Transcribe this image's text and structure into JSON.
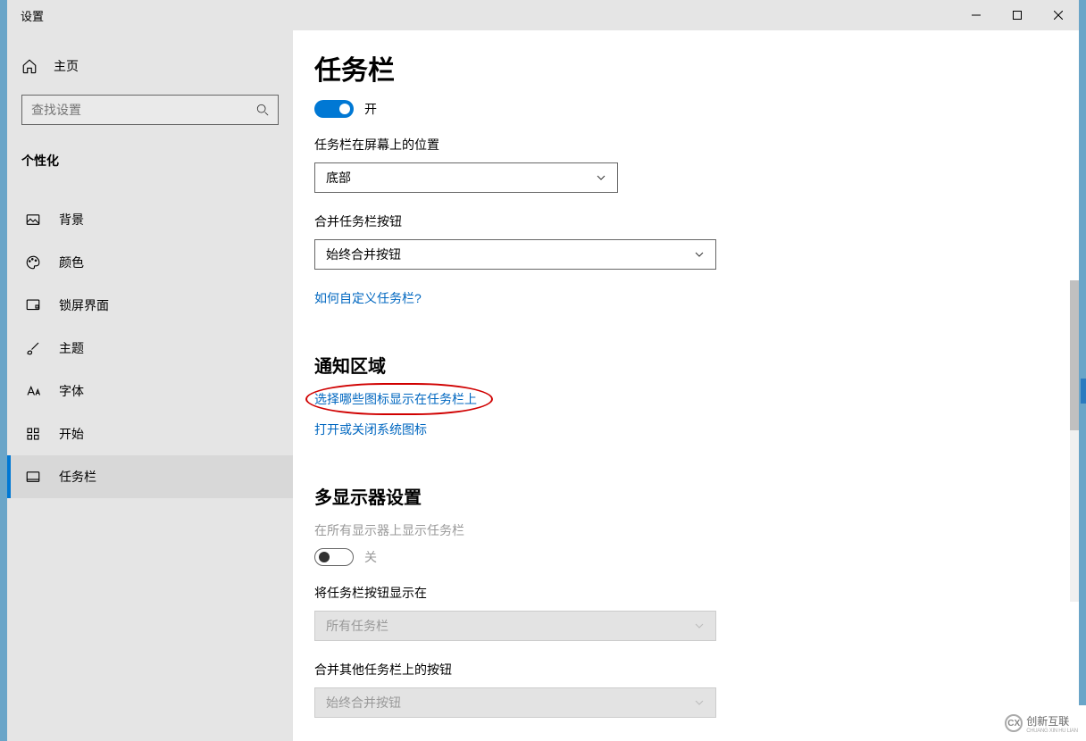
{
  "window": {
    "title": "设置"
  },
  "sidebar": {
    "home": "主页",
    "search_placeholder": "查找设置",
    "section": "个性化",
    "items": [
      {
        "label": "背景"
      },
      {
        "label": "颜色"
      },
      {
        "label": "锁屏界面"
      },
      {
        "label": "主题"
      },
      {
        "label": "字体"
      },
      {
        "label": "开始"
      },
      {
        "label": "任务栏"
      }
    ]
  },
  "content": {
    "title": "任务栏",
    "toggle1_state": "开",
    "position_label": "任务栏在屏幕上的位置",
    "position_value": "底部",
    "combine_label": "合并任务栏按钮",
    "combine_value": "始终合并按钮",
    "how_link": "如何自定义任务栏?",
    "section_notify": "通知区域",
    "link_icons": "选择哪些图标显示在任务栏上",
    "link_sysicons": "打开或关闭系统图标",
    "section_multi": "多显示器设置",
    "multi_label": "在所有显示器上显示任务栏",
    "toggle2_state": "关",
    "show_on_label": "将任务栏按钮显示在",
    "show_on_value": "所有任务栏",
    "combine_other_label": "合并其他任务栏上的按钮",
    "combine_other_value": "始终合并按钮"
  },
  "watermark": {
    "brand": "创新互联",
    "sub": "CHUANG XIN HU LIAN"
  }
}
